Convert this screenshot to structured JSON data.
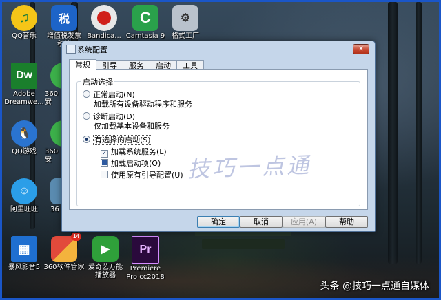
{
  "desktop_icons": [
    {
      "label": "QQ音乐",
      "icon": "qq-music-icon",
      "color": "#f5c518"
    },
    {
      "label": "增值税发票\n税控...",
      "icon": "tax-app-icon",
      "color": "#1d64c8"
    },
    {
      "label": "Bandica...",
      "icon": "bandicam-icon",
      "color": "#e8e8e8"
    },
    {
      "label": "Camtasia 9",
      "icon": "camtasia-icon",
      "color": "#2aa14b"
    },
    {
      "label": "格式工厂",
      "icon": "format-factory-icon",
      "color": "#b9c2cc"
    },
    {
      "label": "Adobe\nDreamwe...",
      "icon": "dreamweaver-icon",
      "color": "#1a7f2c"
    },
    {
      "label": "360安",
      "icon": "360-safe-icon",
      "color": "#3cb04a"
    },
    {
      "label": "QQ游戏",
      "icon": "qq-game-icon",
      "color": "#2a74d0"
    },
    {
      "label": "360安",
      "icon": "360-browser-icon",
      "color": "#3cb04a"
    },
    {
      "label": "阿里旺旺",
      "icon": "aliwangwang-icon",
      "color": "#2b9ee8"
    },
    {
      "label": "36",
      "icon": "generic-app-icon",
      "color": "#5a8bb0"
    },
    {
      "label": "暴风影音5",
      "icon": "baofeng-icon",
      "color": "#1f6fd0"
    },
    {
      "label": "360软件管家",
      "icon": "360-software-manager-icon",
      "color": "#e24a3b",
      "badge": "14"
    },
    {
      "label": "爱奇艺万能\n播放器",
      "icon": "iqiyi-player-icon",
      "color": "#2fa03a"
    },
    {
      "label": "Premiere\nPro cc2018",
      "icon": "premiere-icon",
      "color": "#2a0a3c"
    }
  ],
  "dialog": {
    "title": "系统配置",
    "close_glyph": "✕",
    "tabs": [
      "常规",
      "引导",
      "服务",
      "启动",
      "工具"
    ],
    "active_tab": "常规",
    "group_title": "启动选择",
    "options": [
      {
        "label": "正常启动(N)",
        "desc": "加载所有设备驱动程序和服务",
        "selected": false
      },
      {
        "label": "诊断启动(D)",
        "desc": "仅加载基本设备和服务",
        "selected": false
      },
      {
        "label": "有选择的启动(S)",
        "selected": true
      }
    ],
    "checks": [
      {
        "label": "加载系统服务(L)",
        "state": "checked"
      },
      {
        "label": "加载启动项(O)",
        "state": "partial"
      },
      {
        "label": "使用原有引导配置(U)",
        "state": "unchecked"
      }
    ],
    "buttons": {
      "ok": "确定",
      "cancel": "取消",
      "apply": "应用(A)",
      "help": "帮助"
    },
    "watermark": "技巧一点通"
  },
  "caption": "头条 @技巧一点通自媒体"
}
